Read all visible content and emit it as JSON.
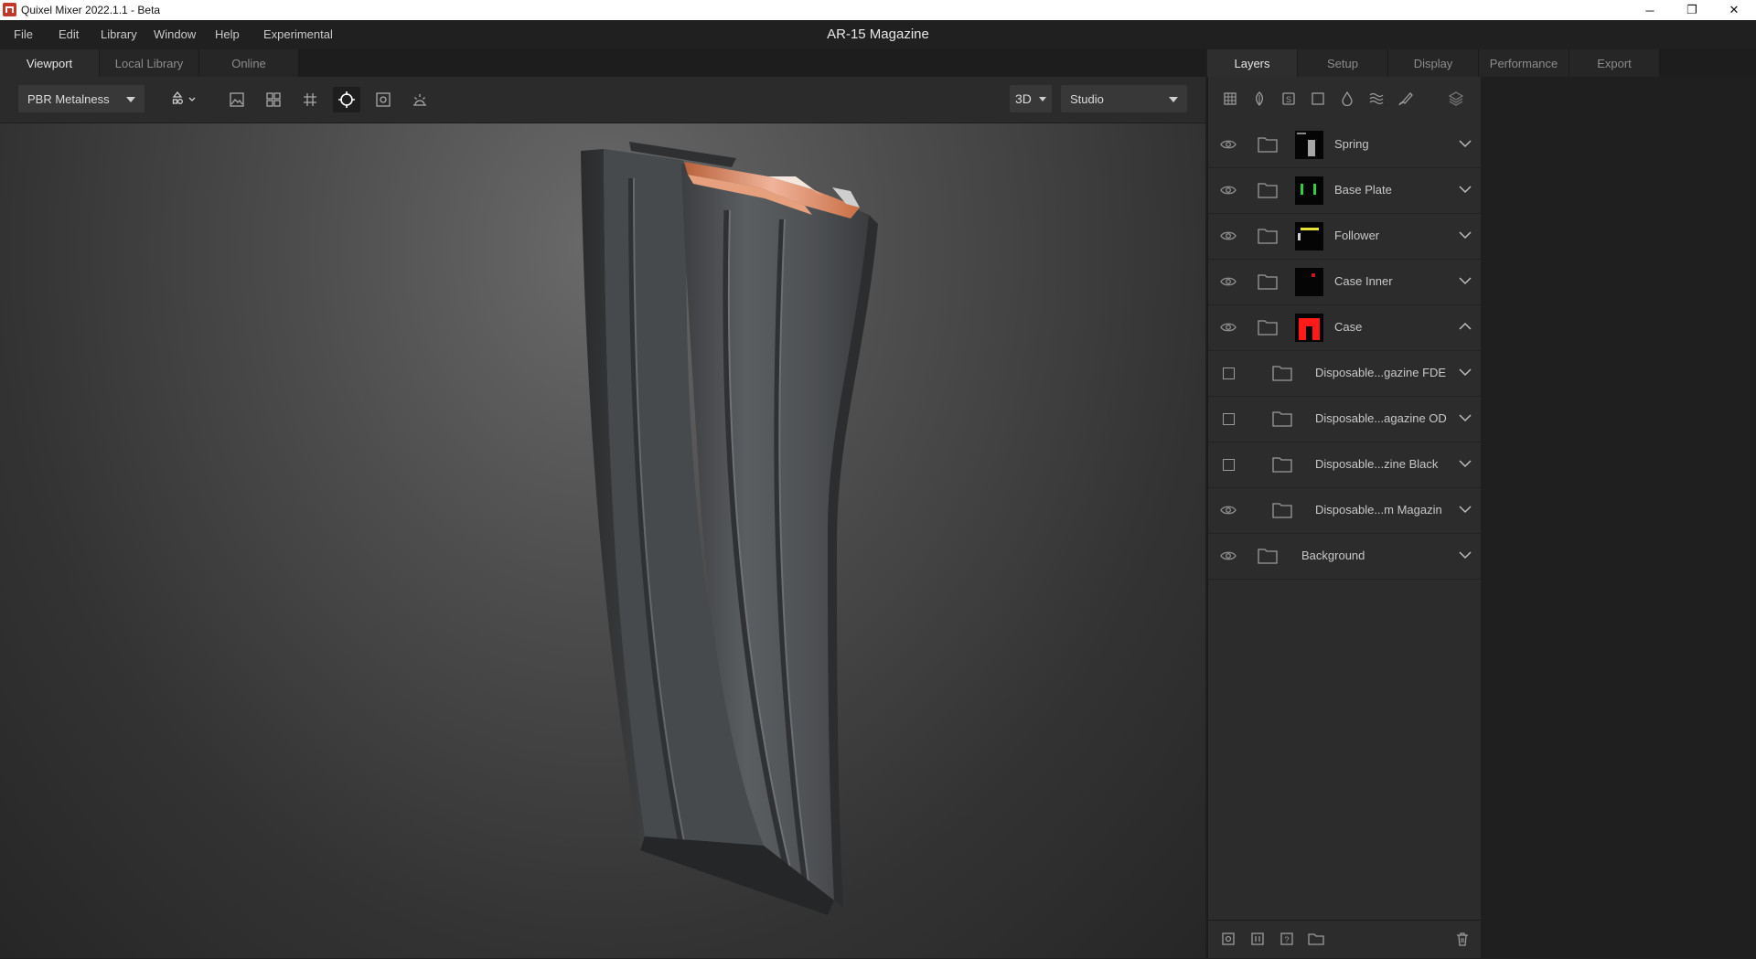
{
  "window": {
    "title": "Quixel Mixer 2022.1.1 - Beta",
    "minimize": "─",
    "restore": "❐",
    "close": "✕"
  },
  "menu": {
    "items": [
      "File",
      "Edit",
      "Library",
      "Window",
      "Help",
      "Experimental"
    ],
    "document_title": "AR-15 Magazine"
  },
  "left_tabs": [
    {
      "label": "Viewport",
      "active": true
    },
    {
      "label": "Local Library",
      "active": false
    },
    {
      "label": "Online",
      "active": false
    }
  ],
  "toolbar": {
    "material_mode": "PBR Metalness",
    "view_mode": "3D",
    "environment": "Studio",
    "buttons": [
      "shape-picker-icon",
      "image-icon",
      "grid-four-icon",
      "grid-lines-icon",
      "crosshair-icon",
      "frame-icon",
      "light-icon"
    ],
    "active_button": "crosshair-icon"
  },
  "right_tabs": [
    {
      "label": "Layers",
      "active": true
    },
    {
      "label": "Setup",
      "active": false
    },
    {
      "label": "Display",
      "active": false
    },
    {
      "label": "Performance",
      "active": false
    },
    {
      "label": "Export",
      "active": false
    }
  ],
  "layer_tools": [
    "solid-layer-icon",
    "surface-icon",
    "smart-material-icon",
    "mask-icon",
    "fill-icon",
    "displacement-icon",
    "paint-icon",
    "layer-stack-icon"
  ],
  "layers": [
    {
      "name": "Spring",
      "visibility": "eye",
      "indent": 0,
      "expanded": false,
      "thumb_color": "#cfcfcf"
    },
    {
      "name": "Base Plate",
      "visibility": "eye",
      "indent": 0,
      "expanded": false,
      "thumb_color": "#2ed13a"
    },
    {
      "name": "Follower",
      "visibility": "eye",
      "indent": 0,
      "expanded": false,
      "thumb_color": "#e8e23a"
    },
    {
      "name": "Case Inner",
      "visibility": "eye",
      "indent": 0,
      "expanded": false,
      "thumb_color": "#c8161a"
    },
    {
      "name": "Case",
      "visibility": "eye",
      "indent": 0,
      "expanded": true,
      "thumb_color": "#ff1a1a"
    },
    {
      "name": "Disposable...gazine FDE",
      "visibility": "checkbox",
      "indent": 1,
      "expanded": false
    },
    {
      "name": "Disposable...agazine OD",
      "visibility": "checkbox",
      "indent": 1,
      "expanded": false
    },
    {
      "name": "Disposable...zine Black",
      "visibility": "checkbox",
      "indent": 1,
      "expanded": false
    },
    {
      "name": "Disposable...m Magazin",
      "visibility": "eye",
      "indent": 1,
      "expanded": false
    },
    {
      "name": "Background",
      "visibility": "eye",
      "indent": 0,
      "expanded": false
    }
  ],
  "footer_tools": [
    "add-layer-icon",
    "add-mask-icon",
    "smart-icon",
    "add-folder-icon",
    "delete-icon"
  ],
  "colors": {
    "accent_copper": "#d9825a",
    "magazine_body": "#55585a"
  }
}
